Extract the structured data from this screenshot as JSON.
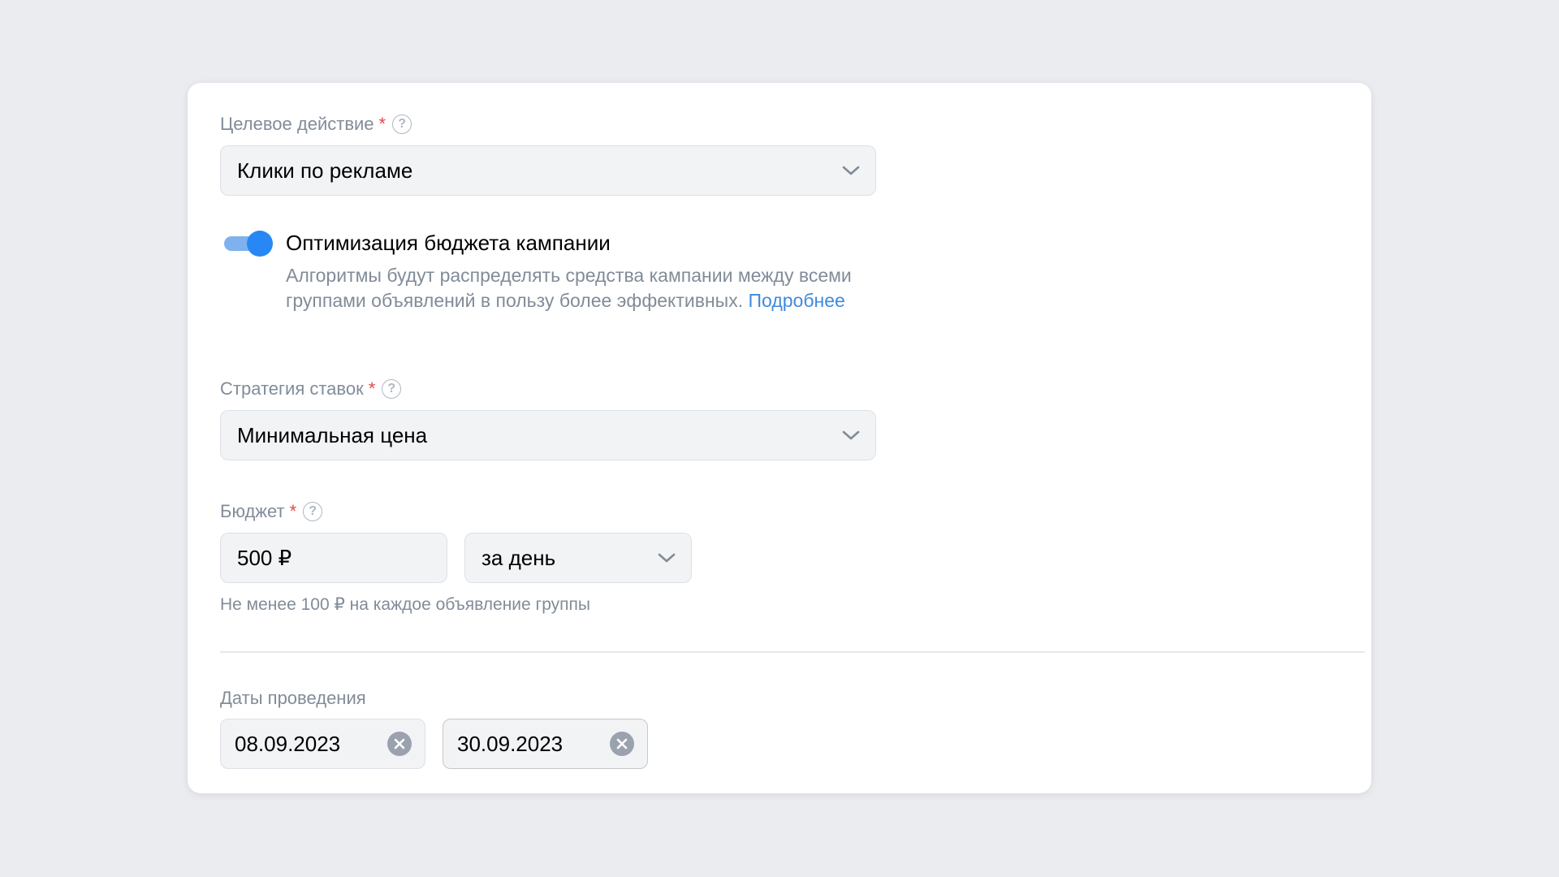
{
  "target_action": {
    "label": "Целевое действие",
    "required_mark": "*",
    "help_icon": "question-circle-icon",
    "value": "Клики по рекламе"
  },
  "budget_optimization": {
    "enabled": true,
    "title": "Оптимизация бюджета кампании",
    "description": "Алгоритмы будут распределять средства кампании между всеми группами объявлений в пользу более эффективных.",
    "link": "Подробнее"
  },
  "bid_strategy": {
    "label": "Стратегия ставок",
    "required_mark": "*",
    "help_icon": "question-circle-icon",
    "value": "Минимальная цена"
  },
  "budget": {
    "label": "Бюджет",
    "required_mark": "*",
    "help_icon": "question-circle-icon",
    "amount": "500 ₽",
    "period": "за день",
    "hint": "Не менее 100 ₽ на каждое объявление группы"
  },
  "dates": {
    "label": "Даты проведения",
    "start": "08.09.2023",
    "end": "30.09.2023",
    "clear_icon": "clear-circle-icon"
  },
  "colors": {
    "accent": "#2787f5",
    "toggle_track": "#7eb1ee",
    "link": "#3f8ae0",
    "required": "#e64646",
    "secondary_text": "#818c99",
    "background": "#ebecf0"
  }
}
